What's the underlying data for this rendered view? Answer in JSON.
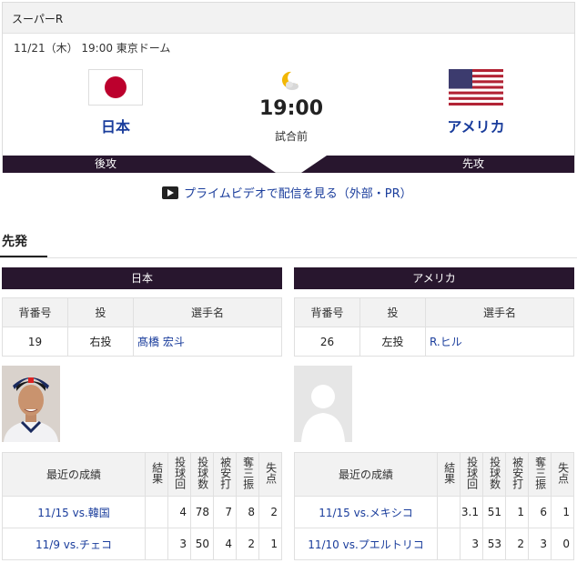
{
  "round": "スーパーR",
  "date_line": "11/21（木） 19:00 東京ドーム",
  "home": {
    "name": "日本",
    "side": "後攻"
  },
  "away": {
    "name": "アメリカ",
    "side": "先攻"
  },
  "time": "19:00",
  "status": "試合前",
  "icons": {
    "weather": "moon-cloud-icon",
    "play": "play-icon"
  },
  "prime_link": "プライムビデオで配信を見る（外部・PR）",
  "section_title": "先発",
  "starter_headers": [
    "背番号",
    "投",
    "選手名"
  ],
  "recent_headers": {
    "games": "最近の成績",
    "result": "結果",
    "innings": "投球回",
    "pitches": "投球数",
    "hits": "被安打",
    "strikeouts": "奪三振",
    "runs": "失点"
  },
  "japan": {
    "team_label": "日本",
    "starter": {
      "number": "19",
      "throws": "右投",
      "name": "髙橋 宏斗"
    },
    "games": [
      {
        "game": "11/15 vs.韓国",
        "result": "",
        "innings": "4",
        "pitches": "78",
        "hits": "7",
        "strikeouts": "8",
        "runs": "2"
      },
      {
        "game": "11/9 vs.チェコ",
        "result": "",
        "innings": "3",
        "pitches": "50",
        "hits": "4",
        "strikeouts": "2",
        "runs": "1"
      }
    ]
  },
  "usa": {
    "team_label": "アメリカ",
    "starter": {
      "number": "26",
      "throws": "左投",
      "name": "R.ヒル"
    },
    "games": [
      {
        "game": "11/15 vs.メキシコ",
        "result": "",
        "innings": "3.1",
        "pitches": "51",
        "hits": "1",
        "strikeouts": "6",
        "runs": "1"
      },
      {
        "game": "11/10 vs.プエルトリコ",
        "result": "",
        "innings": "3",
        "pitches": "53",
        "hits": "2",
        "strikeouts": "3",
        "runs": "0"
      }
    ]
  },
  "colors": {
    "navy_bar": "#28162e",
    "link": "#1a3d9c",
    "jp_red": "#bc002d"
  }
}
